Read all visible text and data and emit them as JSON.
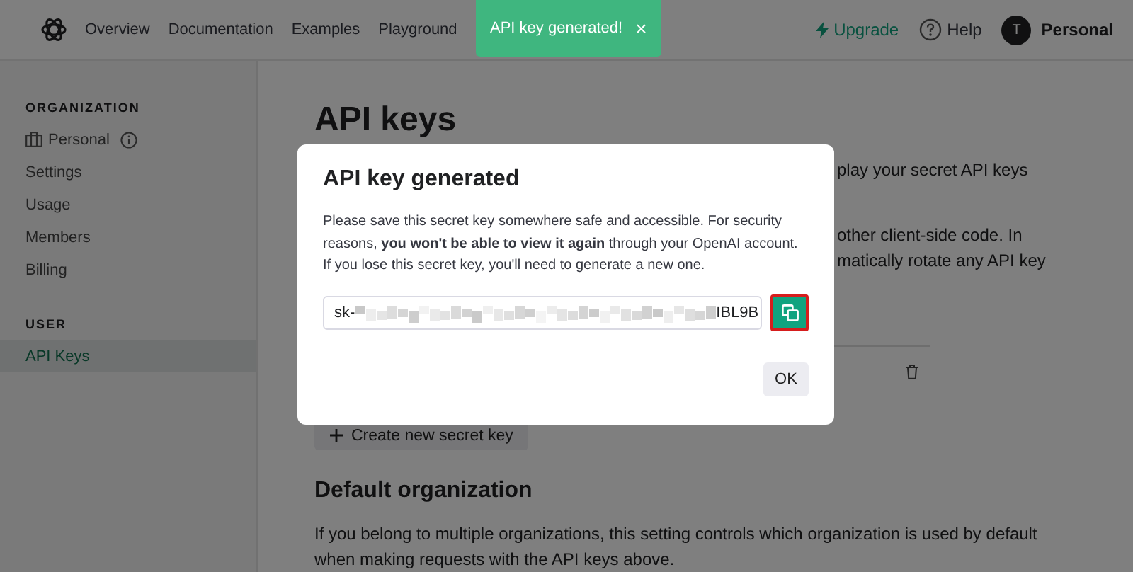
{
  "nav": {
    "links": [
      {
        "label": "Overview"
      },
      {
        "label": "Documentation"
      },
      {
        "label": "Examples"
      },
      {
        "label": "Playground"
      }
    ],
    "upgrade": "Upgrade",
    "help": "Help",
    "avatar": "T",
    "account": "Personal"
  },
  "toast": {
    "message": "API key generated!",
    "close": "×"
  },
  "sidebar": {
    "sections": [
      {
        "heading": "ORGANIZATION",
        "items": [
          {
            "label": "Personal",
            "kind": "org",
            "selected": false
          },
          {
            "label": "Settings",
            "kind": "link",
            "selected": false
          },
          {
            "label": "Usage",
            "kind": "link",
            "selected": false
          },
          {
            "label": "Members",
            "kind": "link",
            "selected": false
          },
          {
            "label": "Billing",
            "kind": "link",
            "selected": false
          }
        ]
      },
      {
        "heading": "USER",
        "items": [
          {
            "label": "API Keys",
            "kind": "link",
            "selected": true
          }
        ]
      }
    ]
  },
  "main": {
    "title": "API keys",
    "visible_fragments": [
      "play your secret API keys",
      "other client-side code. In",
      "matically rotate any API key"
    ],
    "create_button": "Create new secret key",
    "default_org": {
      "heading": "Default organization",
      "text": "If you belong to multiple organizations, this setting controls which organization is used by default when making requests with the API keys above."
    }
  },
  "dialog": {
    "title": "API key generated",
    "text": "Please save this secret key somewhere safe and accessible. For security reasons, **you won't be able to view it again** through your OpenAI account. If you lose this secret key, you'll need to generate a new one.",
    "key_prefix": "sk-",
    "key_suffix": "IBL9B",
    "ok": "OK"
  }
}
